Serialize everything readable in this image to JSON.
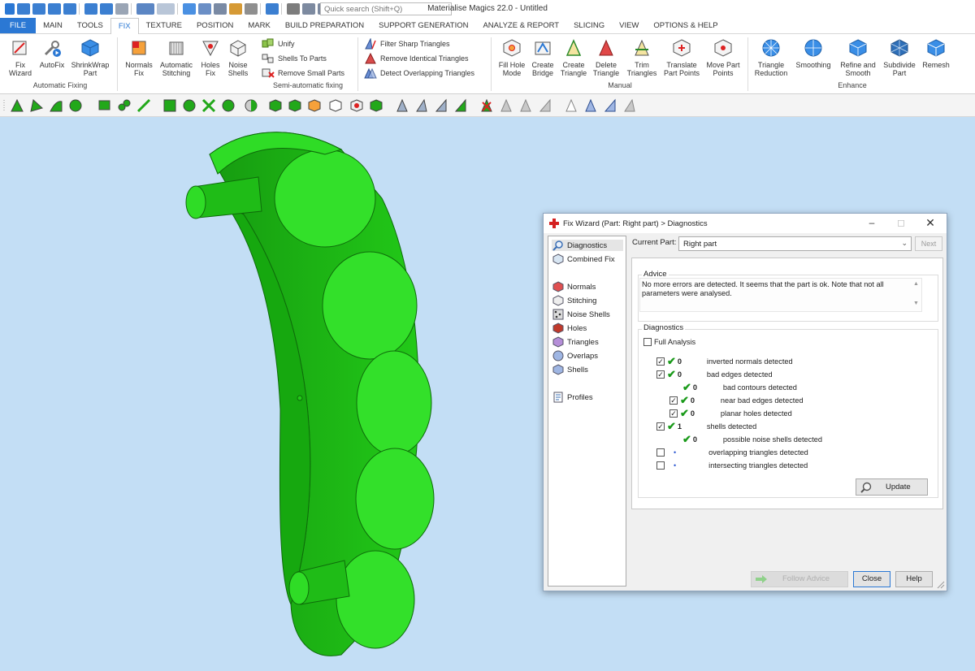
{
  "app": {
    "title": "Materialise Magics 22.0 - Untitled",
    "search_placeholder": "Quick search (Shift+Q)"
  },
  "tabs": [
    "FILE",
    "MAIN",
    "TOOLS",
    "FIX",
    "TEXTURE",
    "POSITION",
    "MARK",
    "BUILD PREPARATION",
    "SUPPORT GENERATION",
    "ANALYZE & REPORT",
    "SLICING",
    "VIEW",
    "OPTIONS & HELP"
  ],
  "active_tab": "FIX",
  "ribbon": {
    "automatic_fixing": {
      "label": "Automatic Fixing",
      "buttons": [
        {
          "line1": "Fix",
          "line2": "Wizard"
        },
        {
          "line1": "AutoFix",
          "line2": ""
        },
        {
          "line1": "ShrinkWrap",
          "line2": "Part"
        }
      ]
    },
    "semi_automatic": {
      "label": "Semi-automatic fixing",
      "buttons": [
        {
          "line1": "Normals",
          "line2": "Fix"
        },
        {
          "line1": "Automatic",
          "line2": "Stitching"
        },
        {
          "line1": "Holes",
          "line2": "Fix"
        },
        {
          "line1": "Noise",
          "line2": "Shells"
        }
      ],
      "small": [
        "Unify",
        "Shells To Parts",
        "Remove Small Parts"
      ]
    },
    "triangles": [
      "Filter Sharp Triangles",
      "Remove Identical Triangles",
      "Detect Overlapping Triangles"
    ],
    "manual": {
      "label": "Manual",
      "buttons": [
        {
          "line1": "Fill Hole",
          "line2": "Mode"
        },
        {
          "line1": "Create",
          "line2": "Bridge"
        },
        {
          "line1": "Create",
          "line2": "Triangle"
        },
        {
          "line1": "Delete",
          "line2": "Triangle"
        },
        {
          "line1": "Trim",
          "line2": "Triangles"
        },
        {
          "line1": "Translate",
          "line2": "Part Points"
        },
        {
          "line1": "Move Part",
          "line2": "Points"
        }
      ]
    },
    "enhance": {
      "label": "Enhance",
      "buttons": [
        {
          "line1": "Triangle",
          "line2": "Reduction"
        },
        {
          "line1": "Smoothing",
          "line2": ""
        },
        {
          "line1": "Refine and",
          "line2": "Smooth"
        },
        {
          "line1": "Subdivide",
          "line2": "Part"
        },
        {
          "line1": "Remesh",
          "line2": ""
        }
      ]
    }
  },
  "dialog": {
    "title": "Fix Wizard (Part: Right part) > Diagnostics",
    "nav": {
      "top": [
        "Diagnostics",
        "Combined Fix"
      ],
      "middle": [
        "Normals",
        "Stitching",
        "Noise Shells",
        "Holes",
        "Triangles",
        "Overlaps",
        "Shells"
      ],
      "bottom": [
        "Profiles"
      ]
    },
    "current_part_label": "Current Part:",
    "current_part_value": "Right part",
    "next_label": "Next",
    "advice_legend": "Advice",
    "advice_text": "No more errors are detected. It seems that the part is ok. Note that not all parameters were analysed.",
    "diagnostics_legend": "Diagnostics",
    "full_analysis": "Full Analysis",
    "rows": [
      {
        "count": "0",
        "text": "inverted normals detected"
      },
      {
        "count": "0",
        "text": "bad edges detected"
      },
      {
        "count": "0",
        "text": "bad contours detected"
      },
      {
        "count": "0",
        "text": "near bad edges detected"
      },
      {
        "count": "0",
        "text": "planar holes detected"
      },
      {
        "count": "1",
        "text": "shells detected"
      },
      {
        "count": "0",
        "text": "possible noise shells detected"
      },
      {
        "count": "",
        "text": "overlapping triangles detected"
      },
      {
        "count": "",
        "text": "intersecting triangles detected"
      }
    ],
    "update_label": "Update",
    "follow_advice_label": "Follow Advice",
    "close_label": "Close",
    "help_label": "Help",
    "colors": {
      "accent": "#2b78d4",
      "check": "#1a9a1a",
      "model": "#22d41a"
    }
  }
}
